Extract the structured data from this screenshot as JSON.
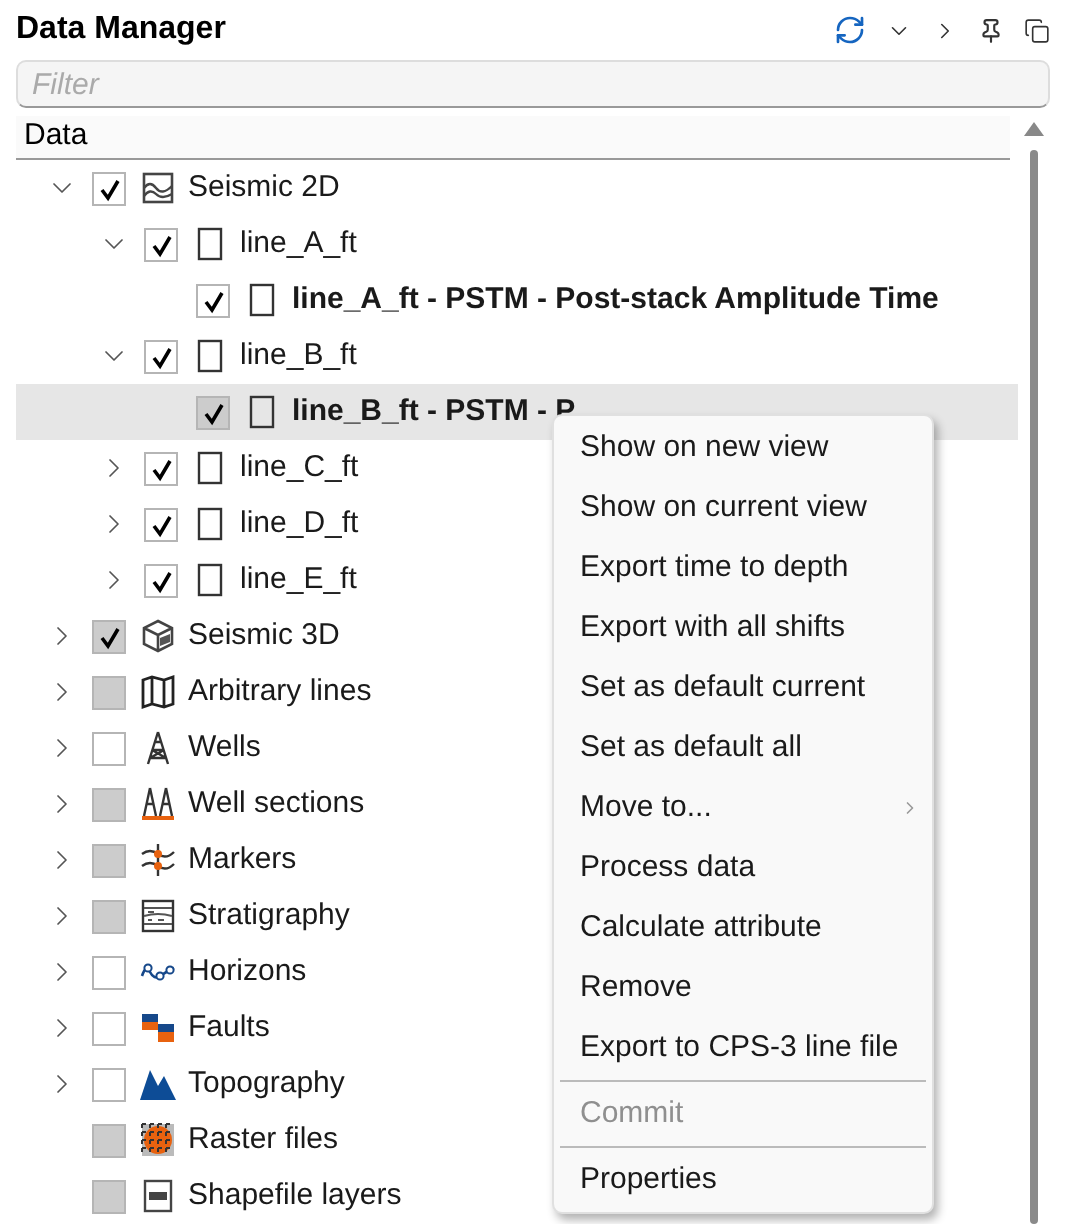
{
  "panel": {
    "title": "Data Manager"
  },
  "filter": {
    "placeholder": "Filter"
  },
  "tree": {
    "column": "Data",
    "nodes": [
      {
        "label": "Seismic 2D",
        "kind": "seismic2d",
        "expanded": true,
        "checked": true,
        "disabled": false,
        "bold": false,
        "selected": false,
        "children": [
          {
            "label": "line_A_ft",
            "kind": "line",
            "expanded": true,
            "checked": true,
            "disabled": false,
            "bold": false,
            "selected": false,
            "children": [
              {
                "label": "line_A_ft - PSTM - Post-stack Amplitude Time",
                "kind": "line",
                "checked": true,
                "disabled": false,
                "bold": true,
                "selected": false
              }
            ]
          },
          {
            "label": "line_B_ft",
            "kind": "line",
            "expanded": true,
            "checked": true,
            "disabled": false,
            "bold": false,
            "selected": false,
            "children": [
              {
                "label": "line_B_ft - PSTM - P",
                "kind": "line",
                "checked": true,
                "disabled": true,
                "bold": true,
                "selected": true
              }
            ]
          },
          {
            "label": "line_C_ft",
            "kind": "line",
            "expanded": false,
            "checked": true,
            "disabled": false,
            "bold": false,
            "selected": false
          },
          {
            "label": "line_D_ft",
            "kind": "line",
            "expanded": false,
            "checked": true,
            "disabled": false,
            "bold": false,
            "selected": false
          },
          {
            "label": "line_E_ft",
            "kind": "line",
            "expanded": false,
            "checked": true,
            "disabled": false,
            "bold": false,
            "selected": false
          }
        ]
      },
      {
        "label": "Seismic 3D",
        "kind": "seismic3d",
        "expanded": false,
        "checked": true,
        "disabled": true,
        "bold": false,
        "selected": false
      },
      {
        "label": "Arbitrary lines",
        "kind": "arbitrary",
        "expanded": false,
        "checked": false,
        "disabled": true,
        "bold": false,
        "selected": false
      },
      {
        "label": "Wells",
        "kind": "wells",
        "expanded": false,
        "checked": false,
        "disabled": false,
        "bold": false,
        "selected": false
      },
      {
        "label": "Well sections",
        "kind": "wellsections",
        "expanded": false,
        "checked": false,
        "disabled": true,
        "bold": false,
        "selected": false
      },
      {
        "label": "Markers",
        "kind": "markers",
        "expanded": false,
        "checked": false,
        "disabled": true,
        "bold": false,
        "selected": false
      },
      {
        "label": "Stratigraphy",
        "kind": "stratigraphy",
        "expanded": false,
        "checked": false,
        "disabled": true,
        "bold": false,
        "selected": false
      },
      {
        "label": "Horizons",
        "kind": "horizons",
        "expanded": false,
        "checked": false,
        "disabled": false,
        "bold": false,
        "selected": false
      },
      {
        "label": "Faults",
        "kind": "faults",
        "expanded": false,
        "checked": false,
        "disabled": false,
        "bold": false,
        "selected": false
      },
      {
        "label": "Topography",
        "kind": "topography",
        "expanded": false,
        "checked": false,
        "disabled": false,
        "bold": false,
        "selected": false
      },
      {
        "label": "Raster files",
        "kind": "raster",
        "checked": false,
        "disabled": true,
        "bold": false,
        "selected": false
      },
      {
        "label": "Shapefile layers",
        "kind": "shapefile",
        "checked": false,
        "disabled": true,
        "bold": false,
        "selected": false
      }
    ]
  },
  "context_menu": [
    {
      "kind": "item",
      "label": "Show on new view",
      "disabled": false,
      "submenu": false
    },
    {
      "kind": "item",
      "label": "Show on current view",
      "disabled": false,
      "submenu": false
    },
    {
      "kind": "item",
      "label": "Export time to depth",
      "disabled": false,
      "submenu": false
    },
    {
      "kind": "item",
      "label": "Export with all shifts",
      "disabled": false,
      "submenu": false
    },
    {
      "kind": "item",
      "label": "Set as default current",
      "disabled": false,
      "submenu": false
    },
    {
      "kind": "item",
      "label": "Set as default all",
      "disabled": false,
      "submenu": false
    },
    {
      "kind": "item",
      "label": "Move to...",
      "disabled": false,
      "submenu": true
    },
    {
      "kind": "item",
      "label": "Process data",
      "disabled": false,
      "submenu": false
    },
    {
      "kind": "item",
      "label": "Calculate attribute",
      "disabled": false,
      "submenu": false
    },
    {
      "kind": "item",
      "label": "Remove",
      "disabled": false,
      "submenu": false
    },
    {
      "kind": "item",
      "label": "Export to CPS-3 line file",
      "disabled": false,
      "submenu": false
    },
    {
      "kind": "separator"
    },
    {
      "kind": "item",
      "label": "Commit",
      "disabled": true,
      "submenu": false
    },
    {
      "kind": "separator"
    },
    {
      "kind": "item",
      "label": "Properties",
      "disabled": false,
      "submenu": false
    }
  ]
}
